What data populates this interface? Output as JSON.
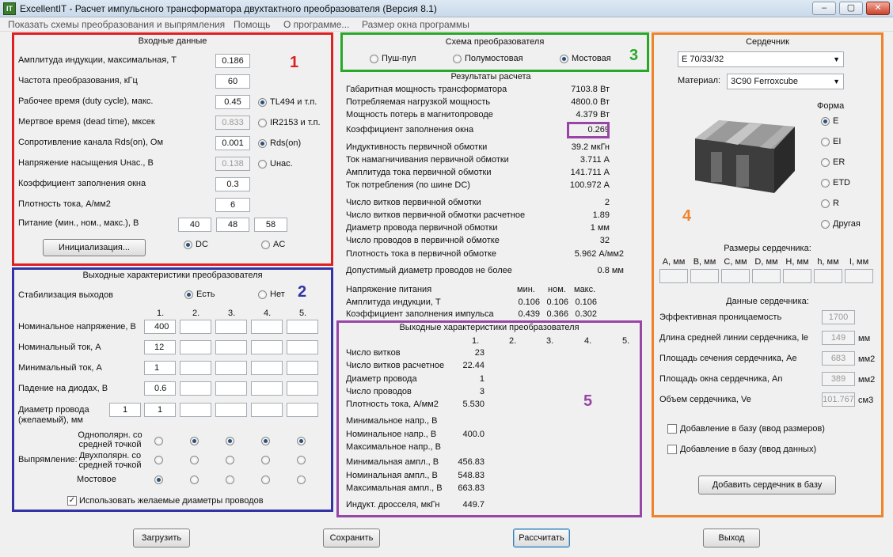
{
  "window": {
    "title": "ExcellentIT - Расчет импульсного трансформатора двухтактного преобразователя (Версия 8.1)",
    "app_icon": "app-icon",
    "min": "▭",
    "max": "▢",
    "close": "✕"
  },
  "menu": [
    "Показать схемы преобразования и выпрямления",
    "Помощь",
    "О программе...",
    "Размер окна программы"
  ],
  "colors": {
    "g1": "#e02020",
    "g2": "#3333a5",
    "g3": "#28a828",
    "g4": "#f0822a",
    "g5": "#9846a6"
  },
  "input": {
    "title": "Входные данные",
    "rows": [
      {
        "label": "Амплитуда индукции, максимальная, Т",
        "value": "0.186"
      },
      {
        "label": "Частота преобразования, кГц",
        "value": "60"
      },
      {
        "label": "Рабочее время (duty cycle), макс.",
        "value": "0.45"
      },
      {
        "label": "Мертвое время (dead time), мксек",
        "value": "0.833"
      },
      {
        "label": "Сопротивление канала Rds(on), Ом",
        "value": "0.001"
      },
      {
        "label": "Напряжение насыщения Uнас., В",
        "value": "0.138"
      },
      {
        "label": "Коэффициент заполнения окна",
        "value": "0.3"
      },
      {
        "label": "Плотность тока, А/мм2",
        "value": "6"
      }
    ],
    "supply_label": "Питание (мин., ном., макс.), В",
    "supply": [
      "40",
      "48",
      "58"
    ],
    "radios": [
      "TL494 и т.п.",
      "IR2153 и т.п.",
      "Rds(on)",
      "Uнас."
    ],
    "init_button": "Инициализация...",
    "dc": "DC",
    "ac": "AC",
    "badge": "1"
  },
  "scheme": {
    "title": "Схема преобразователя",
    "options": [
      "Пуш-пул",
      "Полумостовая",
      "Мостовая"
    ],
    "selected": "Мостовая",
    "badge": "3"
  },
  "results": {
    "title": "Результаты расчета",
    "rows": [
      {
        "label": "Габаритная мощность трансформатора",
        "value": "7103.8 Вт"
      },
      {
        "label": "Потребляемая нагрузкой мощность",
        "value": "4800.0 Вт"
      },
      {
        "label": "Мощность потерь в магнитопроводе",
        "value": "4.379 Вт"
      },
      {
        "label": "Коэффициент заполнения окна",
        "value": "0.269"
      },
      {
        "label": "Индуктивность первичной обмотки",
        "value": "39.2 мкГн"
      },
      {
        "label": "Ток намагничивания первичной обмотки",
        "value": "3.711 А"
      },
      {
        "label": "Амплитуда тока первичной обмотки",
        "value": "141.711 А"
      },
      {
        "label": "Ток потребления (по шине DC)",
        "value": "100.972 А"
      },
      {
        "label": "Число витков первичной обмотки",
        "value": "2"
      },
      {
        "label": "Число витков первичной обмотки расчетное",
        "value": "1.89"
      },
      {
        "label": "Диаметр провода первичной обмотки",
        "value": "1 мм"
      },
      {
        "label": "Число проводов в первичной обмотке",
        "value": "32"
      },
      {
        "label": "Плотность тока в первичной обмотке",
        "value": "5.962 А/мм2"
      },
      {
        "label": "Допустимый диаметр проводов не более",
        "value": "0.8 мм"
      }
    ],
    "table_headers": [
      "мин.",
      "ном.",
      "макс."
    ],
    "table_rows": [
      {
        "label": "Напряжение питания",
        "values": [
          "",
          "",
          ""
        ]
      },
      {
        "label": "Амплитуда индукции, Т",
        "values": [
          "0.106",
          "0.106",
          "0.106"
        ]
      },
      {
        "label": "Коэффициент заполнения импульса",
        "values": [
          "0.439",
          "0.366",
          "0.302"
        ]
      }
    ]
  },
  "output_chars": {
    "title": "Выходные характеристики преобразователя",
    "stab_label": "Стабилизация выходов",
    "yes": "Есть",
    "no": "Нет",
    "cols": [
      "1.",
      "2.",
      "3.",
      "4.",
      "5."
    ],
    "rows": [
      {
        "label": "Номинальное напряжение, В",
        "first": "400"
      },
      {
        "label": "Номинальный ток, А",
        "first": "12"
      },
      {
        "label": "Минимальный ток, А",
        "first": "1"
      },
      {
        "label": "Падение на диодах, В",
        "first": "0.6"
      }
    ],
    "wire_label1": "Диаметр провода",
    "wire_label2": "(желаемый), мм",
    "wire_req": "1",
    "wire_first": "1",
    "rect_label": "Выпрямление:",
    "rect_opts": [
      "Однополярн. со средней точкой",
      "Двухполярн. со средней точкой",
      "Мостовое"
    ],
    "use_wires": "Использовать желаемые диаметры проводов",
    "badge": "2"
  },
  "output_results": {
    "title": "Выходные характеристики преобразователя",
    "cols": [
      "1.",
      "2.",
      "3.",
      "4.",
      "5."
    ],
    "rows": [
      {
        "label": "Число витков",
        "value": "23"
      },
      {
        "label": "Число витков расчетное",
        "value": "22.44"
      },
      {
        "label": "Диаметр провода",
        "value": "1"
      },
      {
        "label": "Число проводов",
        "value": "3"
      },
      {
        "label": "Плотность тока, А/мм2",
        "value": "5.530"
      },
      {
        "label": "Минимальное напр., В",
        "value": ""
      },
      {
        "label": "Номинальное напр., В",
        "value": "400.0"
      },
      {
        "label": "Максимальное напр., В",
        "value": ""
      },
      {
        "label": "Минимальная ампл., В",
        "value": "456.83"
      },
      {
        "label": "Номинальная ампл., В",
        "value": "548.83"
      },
      {
        "label": "Максимальная ампл., В",
        "value": "663.83"
      },
      {
        "label": "Индукт. дросселя, мкГн",
        "value": "449.7"
      }
    ],
    "badge": "5"
  },
  "core": {
    "title": "Сердечник",
    "core_value": "E 70/33/32",
    "material_label": "Материал:",
    "material_value": "3C90 Ferroxcube",
    "shape_label": "Форма",
    "shapes": [
      "E",
      "EI",
      "ER",
      "ETD",
      "R",
      "Другая"
    ],
    "selected_shape": "E",
    "dims_title": "Размеры сердечника:",
    "dims": [
      "A, мм",
      "B, мм",
      "C, мм",
      "D, мм",
      "H, мм",
      "h, мм",
      "I, мм"
    ],
    "data_title": "Данные сердечника:",
    "data": [
      {
        "label": "Эффективная проницаемость",
        "value": "1700",
        "unit": ""
      },
      {
        "label": "Длина средней линии сердечника, le",
        "value": "149",
        "unit": "мм"
      },
      {
        "label": "Площадь сечения сердечника, Ae",
        "value": "683",
        "unit": "мм2"
      },
      {
        "label": "Площадь окна сердечника, An",
        "value": "389",
        "unit": "мм2"
      },
      {
        "label": "Объем сердечника, Ve",
        "value": "101.767",
        "unit": "см3"
      }
    ],
    "add_dims": "Добавление в базу (ввод размеров)",
    "add_data": "Добавление в базу (ввод данных)",
    "add_button": "Добавить сердечник в базу",
    "badge": "4"
  },
  "bottom": {
    "load": "Загрузить",
    "save": "Сохранить",
    "calc": "Рассчитать",
    "exit": "Выход"
  }
}
